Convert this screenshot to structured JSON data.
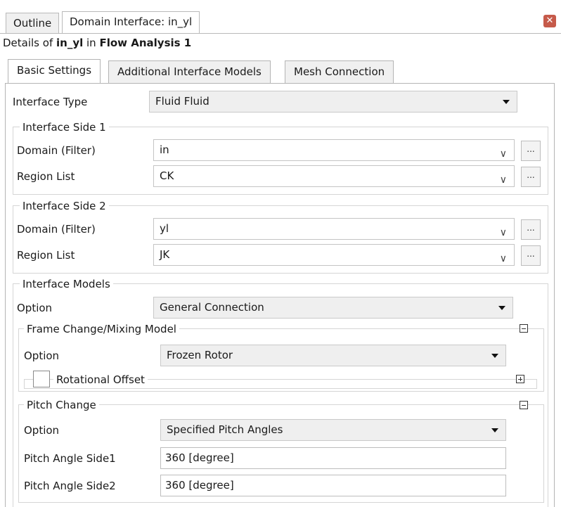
{
  "top_tabs": [
    "Outline",
    "Domain Interface: in_yl"
  ],
  "details": {
    "prefix": "Details of ",
    "object": "in_yl",
    "middle": " in ",
    "analysis": "Flow Analysis 1"
  },
  "sub_tabs": [
    "Basic Settings",
    "Additional Interface Models",
    "Mesh Connection"
  ],
  "interface_type": {
    "label": "Interface Type",
    "value": "Fluid Fluid"
  },
  "side1": {
    "title": "Interface Side 1",
    "domain_label": "Domain (Filter)",
    "domain_value": "in",
    "region_label": "Region List",
    "region_value": "CK",
    "dots": "..."
  },
  "side2": {
    "title": "Interface Side 2",
    "domain_label": "Domain (Filter)",
    "domain_value": "yl",
    "region_label": "Region List",
    "region_value": "JK",
    "dots": "..."
  },
  "models": {
    "title": "Interface Models",
    "option_label": "Option",
    "option_value": "General Connection"
  },
  "frame_change": {
    "title": "Frame Change/Mixing Model",
    "option_label": "Option",
    "option_value": "Frozen Rotor",
    "rotational_offset_label": "Rotational Offset",
    "rotational_offset_checked": false
  },
  "pitch_change": {
    "title": "Pitch Change",
    "option_label": "Option",
    "option_value": "Specified Pitch Angles",
    "side1_label": "Pitch Angle Side1",
    "side1_value": "360 [degree]",
    "side2_label": "Pitch Angle Side2",
    "side2_value": "360 [degree]"
  },
  "close_glyph": "✕"
}
